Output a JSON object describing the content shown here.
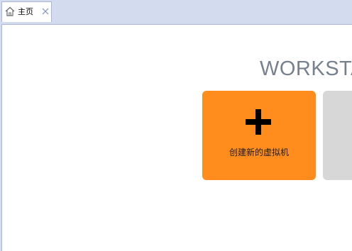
{
  "tab": {
    "label": "主页"
  },
  "brand": {
    "text": "WORKSTA"
  },
  "tiles": [
    {
      "label": "创建新的虚拟机",
      "color": "#fe8d1e",
      "icon": "plus-icon"
    },
    {
      "label": "",
      "color": "#d7d7d7"
    }
  ],
  "colors": {
    "tabbar": "#d3dbef",
    "content": "#ffffff",
    "brand": "#76818d"
  }
}
